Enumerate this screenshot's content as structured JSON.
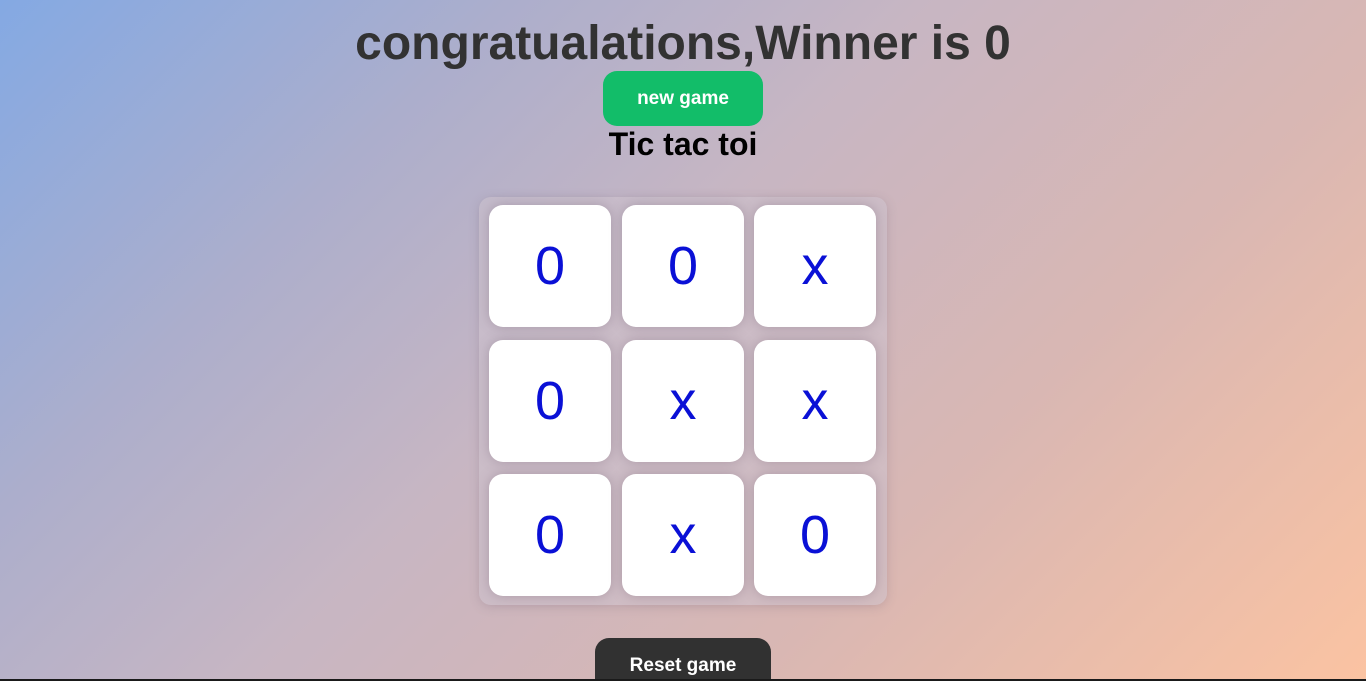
{
  "header": {
    "winner_message": "congratualations,Winner is 0",
    "new_game_label": "new game",
    "title": "Tic tac toi"
  },
  "board": {
    "cells": [
      "0",
      "0",
      "x",
      "0",
      "x",
      "x",
      "0",
      "x",
      "0"
    ]
  },
  "footer": {
    "reset_label": "Reset game"
  },
  "colors": {
    "mark": "#0a10d6",
    "new_game_button": "#12bd69",
    "reset_button": "#313131"
  }
}
